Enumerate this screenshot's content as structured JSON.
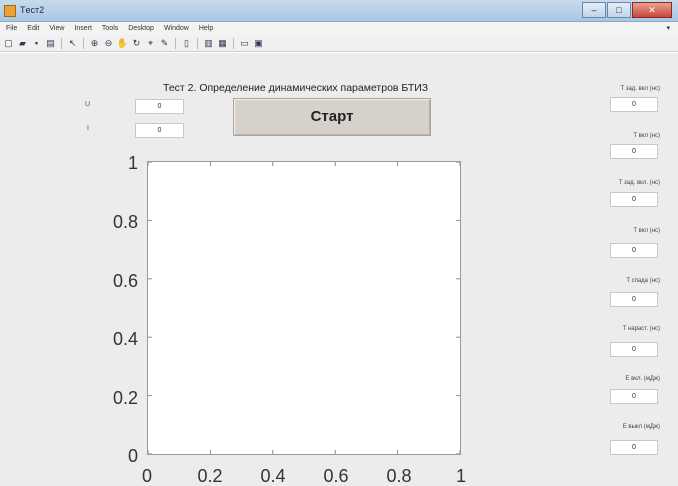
{
  "window": {
    "title": "Tест2",
    "minimize": "–",
    "maximize": "□",
    "close": "✕"
  },
  "menu": [
    "File",
    "Edit",
    "View",
    "Insert",
    "Tools",
    "Desktop",
    "Window",
    "Help"
  ],
  "menu_overflow": "▾",
  "toolbar_icons": [
    "new-icon",
    "open-icon",
    "save-icon",
    "print-icon",
    "pointer-icon",
    "zoom-in-icon",
    "zoom-out-icon",
    "pan-icon",
    "rotate-icon",
    "data-cursor-icon",
    "brush-icon",
    "link-icon",
    "colorbar-icon",
    "legend-icon",
    "hide-plot-icon",
    "show-plot-icon"
  ],
  "header": {
    "title": "Тест 2. Определение динамических параметров БТИЗ"
  },
  "left_params": [
    {
      "label": "U",
      "value": "0"
    },
    {
      "label": "I",
      "value": "0"
    }
  ],
  "start_button": "Старт",
  "right_params": [
    {
      "label": "T зад. вкл (нс)",
      "value": "0"
    },
    {
      "label": "T вкл (нс)",
      "value": "0"
    },
    {
      "label": "T зад. вкл. (нс)",
      "value": "0"
    },
    {
      "label": "T вкл (нс)",
      "value": "0"
    },
    {
      "label": "T спада (нс)",
      "value": "0"
    },
    {
      "label": "T нараст. (нс)",
      "value": "0"
    },
    {
      "label": "E вкл. (мДж)",
      "value": "0"
    },
    {
      "label": "E выкл (мДж)",
      "value": "0"
    }
  ],
  "axes": {
    "ylim": [
      0,
      1
    ],
    "xlim": [
      0,
      1
    ],
    "yticks": [
      "1",
      "0.8",
      "0.6",
      "0.4",
      "0.2",
      "0"
    ],
    "xticks": [
      "0",
      "0.2",
      "0.4",
      "0.6",
      "0.8",
      "1"
    ]
  }
}
